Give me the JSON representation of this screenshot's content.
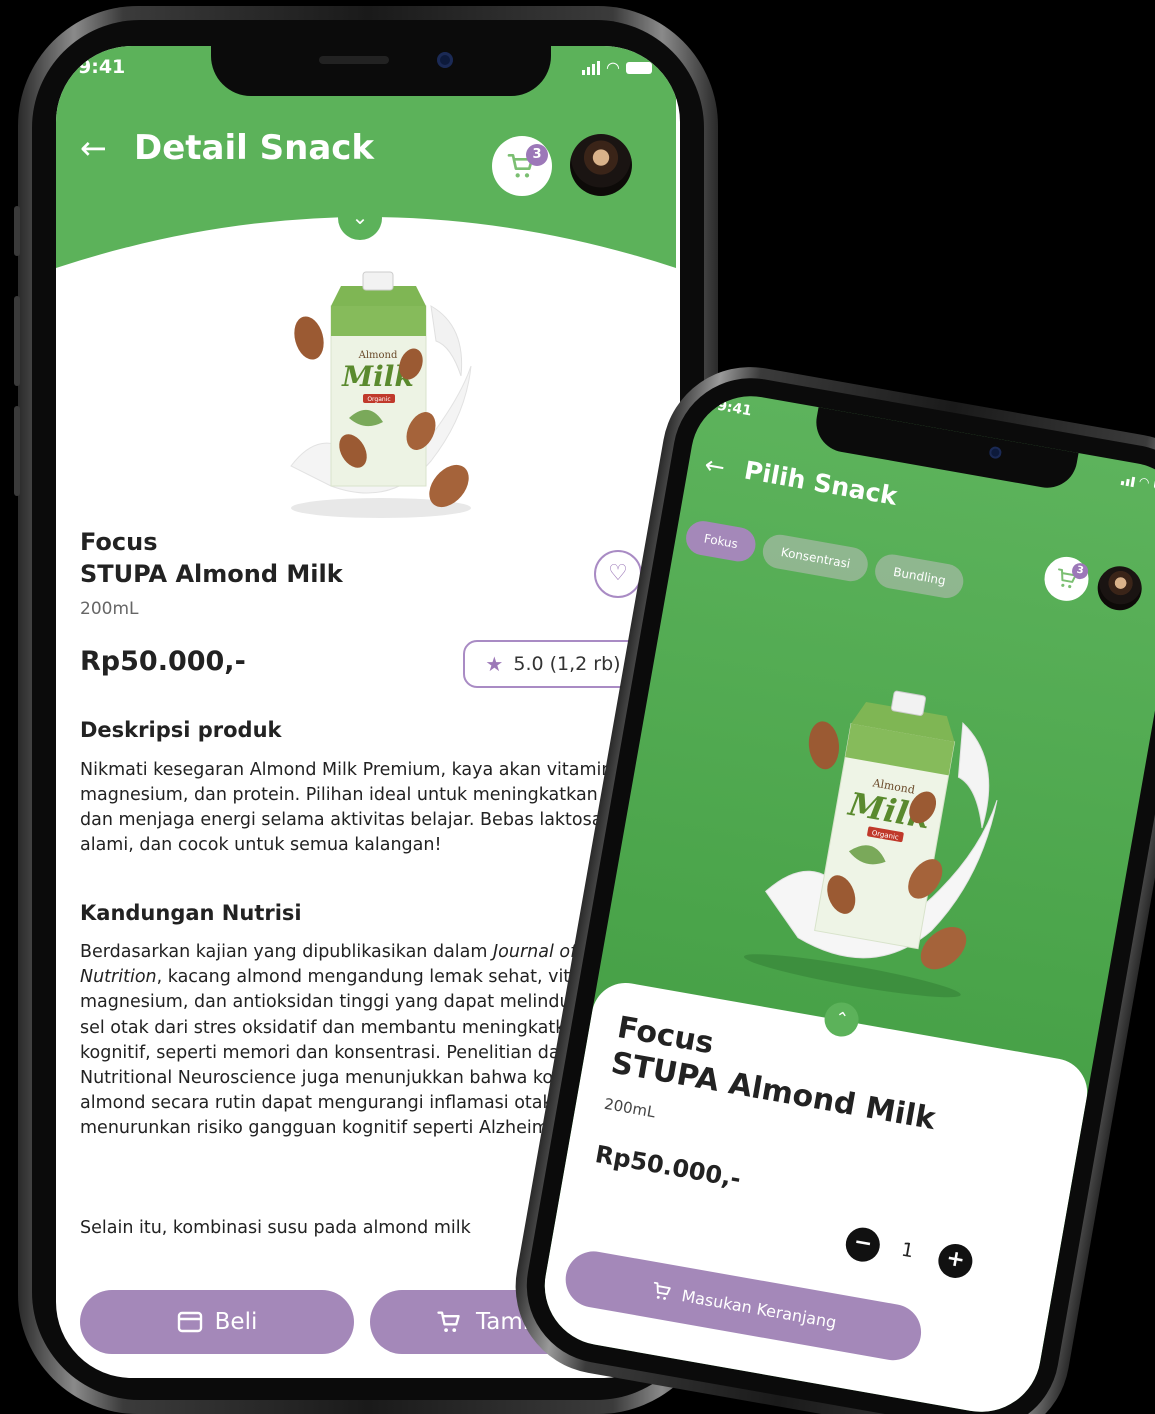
{
  "colors": {
    "primary_green": "#5cb25a",
    "accent_purple": "#a488b9",
    "text_dark": "#222222"
  },
  "detail_screen": {
    "status_time": "9:41",
    "header_title": "Detail Snack",
    "back_icon": "arrow-left-icon",
    "cart_badge": "3",
    "product_category": "Focus",
    "product_name": "STUPA Almond Milk",
    "product_volume": "200mL",
    "product_price": "Rp50.000,-",
    "rating": "5.0 (1,2 rb)",
    "description_heading": "Deskripsi produk",
    "description_text": "Nikmati kesegaran Almond Milk Premium, kaya akan vitamin E, magnesium, dan protein. Pilihan ideal untuk meningkatkan fokus dan menjaga energi selama aktivitas belajar. Bebas laktosa, alami, dan cocok untuk semua kalangan!",
    "nutrition_heading": "Kandungan Nutrisi",
    "nutrition_text_pre": "Berdasarkan kajian yang dipublikasikan dalam ",
    "nutrition_text_journal": "Journal of Nutrition",
    "nutrition_text_post": ", kacang almond mengandung lemak sehat, vitamin E, magnesium, dan antioksidan tinggi yang dapat melindungi sel-sel otak dari stres oksidatif dan membantu meningkatkan fungsi kognitif, seperti memori dan konsentrasi. Penelitian dari Nutritional Neuroscience juga menunjukkan bahwa konsumsi almond secara rutin dapat mengurangi inflamasi otak, sehingga menurunkan risiko gangguan kognitif seperti Alzheimer.",
    "nutrition_text_2": "Selain itu, kombinasi susu pada almond milk",
    "buy_label": "Beli",
    "add_label": "Tambah",
    "carton_brand_small": "Almond",
    "carton_brand_big": "Milk",
    "carton_tag": "Organic"
  },
  "list_screen": {
    "status_time": "9:41",
    "header_title": "Pilih Snack",
    "cart_badge": "3",
    "tabs": [
      {
        "label": "Fokus",
        "active": true
      },
      {
        "label": "Konsentrasi",
        "active": false
      },
      {
        "label": "Bundling",
        "active": false
      }
    ],
    "product_category": "Focus",
    "product_name": "STUPA Almond Milk",
    "product_volume": "200mL",
    "product_price": "Rp50.000,-",
    "quantity": "1",
    "add_to_cart_label": "Masukan Keranjang",
    "carton_brand_small": "Almond",
    "carton_brand_big": "Milk",
    "carton_tag": "Organic"
  }
}
